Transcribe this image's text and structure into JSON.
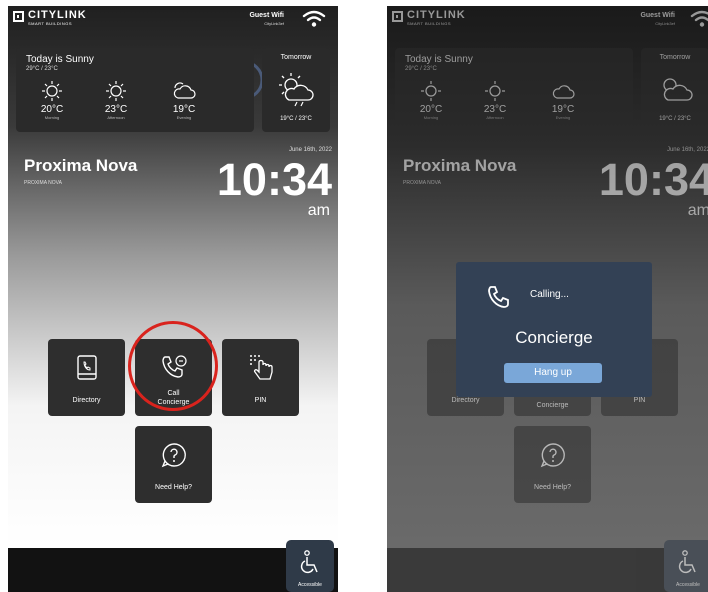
{
  "app": {
    "logo_name": "CITYLINK",
    "logo_sub": "SMART BUILDINGS"
  },
  "wifi": {
    "title": "Guest Wifi",
    "network": "CityLink3ef"
  },
  "weather": {
    "today_title": "Today is Sunny",
    "today_range": "29°C / 23°C",
    "forecasts": [
      {
        "temp": "20°C",
        "period": "Morning",
        "icon": "sun-icon"
      },
      {
        "temp": "23°C",
        "period": "Afternoon",
        "icon": "sun-icon"
      },
      {
        "temp": "19°C",
        "period": "Evening",
        "icon": "cloud-icon"
      }
    ],
    "tomorrow_title": "Tomorrow",
    "tomorrow_range": "19°C / 23°C",
    "tomorrow_icon": "sun-cloud-rain-icon"
  },
  "building": {
    "name": "Proxima Nova",
    "sub": "PROXIMA NOVA"
  },
  "clock": {
    "date": "June 16th, 2022",
    "time": "10:34",
    "ampm": "am"
  },
  "tiles": {
    "directory": "Directory",
    "call_concierge": "Call\nConcierge",
    "call_concierge_dim": "Concierge",
    "pin": "PIN",
    "help": "Need Help?"
  },
  "accessible": {
    "label": "Accessible",
    "icon": "wheelchair-icon"
  },
  "modal": {
    "status": "Calling...",
    "destination": "Concierge",
    "hangup": "Hang up"
  },
  "colors": {
    "highlight_ring": "#d9231d",
    "modal_bg": "#334155",
    "hangup_button": "#7aa7d8"
  }
}
